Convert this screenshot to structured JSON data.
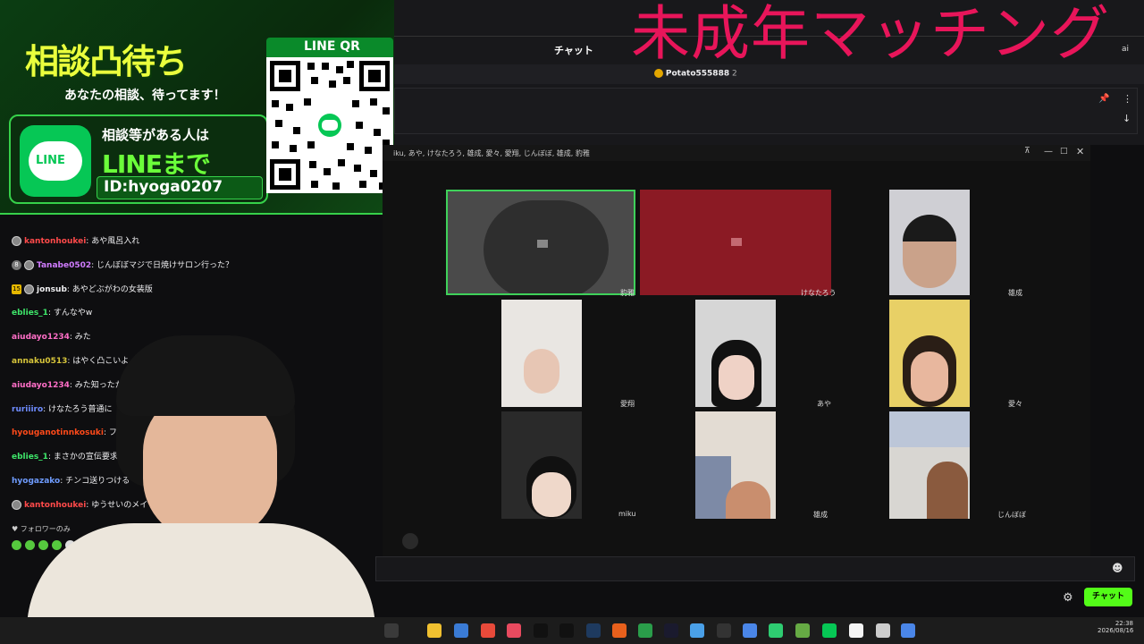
{
  "stream_title": "未成年マッチング",
  "chat_header": {
    "title": "チャット"
  },
  "pinned_user": {
    "name": "Potato555888",
    "count": "2"
  },
  "line_overlay": {
    "headline": "相談凸待ち",
    "subline": "あなたの相談、待ってます！",
    "qr_label": "LINE QR",
    "line_logo": "LINE",
    "cta_small": "相談等がある人は",
    "cta_big": "LINEまで",
    "line_id": "ID:hyoga0207"
  },
  "chat_messages": [
    {
      "badge": "",
      "user": "kantonhoukei",
      "color": "#ff4a4a",
      "text": ": あや風呂入れ"
    },
    {
      "badge": "8",
      "user": "Tanabe0502",
      "color": "#d07cff",
      "text": ": じんぼぼマジで日焼けサロン行った？"
    },
    {
      "badge": "15",
      "user": "jonsub",
      "color": "#efeff1",
      "text": ": あやどぶがわの女装版"
    },
    {
      "badge": "",
      "user": "eblies_1",
      "color": "#3ee66a",
      "text": ": すんなやw"
    },
    {
      "badge": "",
      "user": "aiudayo1234",
      "color": "#ff6ec7",
      "text": ": みた"
    },
    {
      "badge": "",
      "user": "annaku0513",
      "color": "#d6c43a",
      "text": ": はやく凸こいよ"
    },
    {
      "badge": "",
      "user": "aiudayo1234",
      "color": "#ff6ec7",
      "text": ": みた知ったか"
    },
    {
      "badge": "",
      "user": "ruriiiro",
      "color": "#6f8cff",
      "text": ": けなたろう普通に"
    },
    {
      "badge": "",
      "user": "hyouganotinnkosuki",
      "color": "#ff4a1a",
      "text": ": フォ"
    },
    {
      "badge": "",
      "user": "eblies_1",
      "color": "#3ee66a",
      "text": ": まさかの宣伝要求w"
    },
    {
      "badge": "",
      "user": "hyogazako",
      "color": "#6f9cff",
      "text": ": チンコ送りつける"
    },
    {
      "badge": "",
      "user": "kantonhoukei",
      "color": "#ff4a4a",
      "text": ": ゆうせいのメイ"
    }
  ],
  "followers_only": "フォロワーのみ",
  "chat_button": "チャット",
  "video_call": {
    "participants_bar": "iku, あや, けなたろう, 雄成, 愛々, 愛翔, じんぼぼ, 雄成, 豹雅",
    "tiles": [
      {
        "name": "豹雅"
      },
      {
        "name": "けなたろう"
      },
      {
        "name": "雄成"
      },
      {
        "name": "愛翔"
      },
      {
        "name": "あや"
      },
      {
        "name": "愛々"
      },
      {
        "name": "miku"
      },
      {
        "name": "雄成"
      },
      {
        "name": "じんぼぼ"
      }
    ]
  },
  "clock": {
    "time": "22:38",
    "date": "2026/08/16"
  },
  "colors": {
    "line_green": "#06c755",
    "title_pink": "#e8155a",
    "accent": "#53fc18"
  }
}
